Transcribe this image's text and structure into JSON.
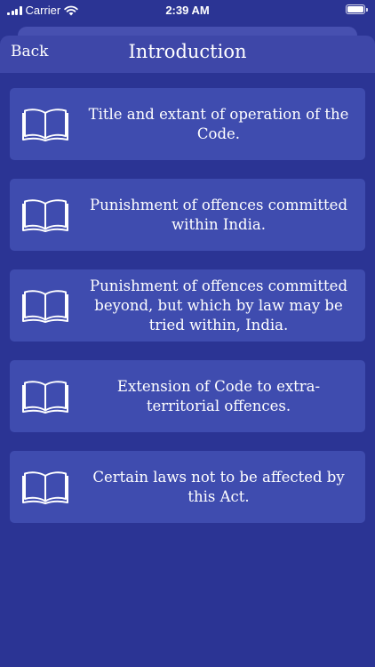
{
  "status_bar": {
    "carrier": "Carrier",
    "time": "2:39 AM"
  },
  "header": {
    "back_label": "Back",
    "title": "Introduction"
  },
  "colors": {
    "background": "#2b3494",
    "nav_bar": "#3e47a8",
    "card": "#3f4caf",
    "text": "#ffffff"
  },
  "sections": [
    {
      "icon": "open-book-icon",
      "text": "Title and extant of operation of the Code."
    },
    {
      "icon": "open-book-icon",
      "text": "Punishment of offences committed within India."
    },
    {
      "icon": "open-book-icon",
      "text": "Punishment of offences committed beyond, but which by law may be tried within, India."
    },
    {
      "icon": "open-book-icon",
      "text": "Extension of Code to extra-territorial offences."
    },
    {
      "icon": "open-book-icon",
      "text": "Certain laws not to be affected by this Act."
    }
  ]
}
